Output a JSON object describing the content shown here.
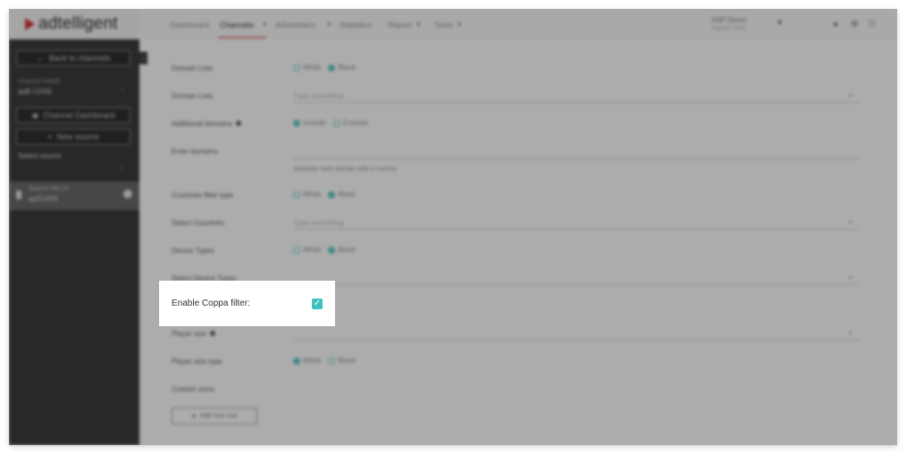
{
  "app": {
    "logo_text": "adtelligent"
  },
  "sidebar": {
    "back_button": "Back to channels",
    "account_label": "Channel NAME",
    "account_value": "qaB CDS5",
    "channel_dashboard_button": "Channel Dashboard",
    "new_source_button": "New source",
    "select_source_label": "Select source",
    "active_source_label": "Source ON 15",
    "active_source_value": "qaS140S"
  },
  "topbar": {
    "nav": [
      "Dashboard",
      "Channels",
      "Advertisers",
      "Statistics",
      "Report",
      "Tools"
    ],
    "active_nav": "Channels",
    "account_name": "SSP Demo",
    "account_sub": "Supplier ID411"
  },
  "form": {
    "domain_lists_1_label": "Domain Lists",
    "domain_lists_2_label": "Domain Lists",
    "additional_domains_label": "Additional domains",
    "enter_domains_label": "Enter domains",
    "enter_domains_hint": "Separate each domain with a comma",
    "countries_filter_label": "Countries filter type",
    "select_countries_label": "Select Countries",
    "device_types_label": "Device Types",
    "select_device_types_label": "Select Device Types",
    "player_size_label": "Player size",
    "player_size_type_label": "Player size type",
    "custom_sizes_label": "Custom sizes",
    "add_new_size_button": "Add new size",
    "type_something_placeholder": "Type something",
    "white": "White",
    "black": "Black",
    "include": "Include",
    "exclude": "Exclude"
  },
  "highlight": {
    "label": "Enable Coppa filter:",
    "checked": true,
    "accent": "#3cc3c0"
  }
}
